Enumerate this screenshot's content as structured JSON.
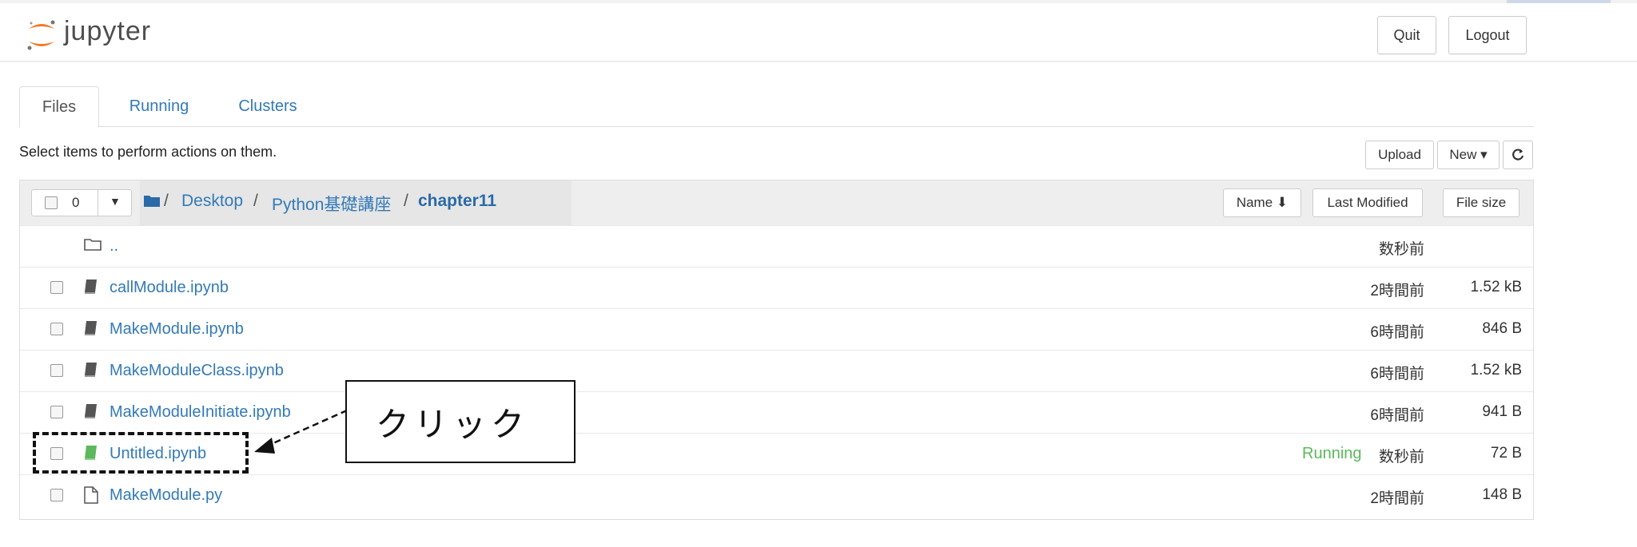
{
  "app": {
    "logo_text": "jupyter"
  },
  "header": {
    "quit_label": "Quit",
    "logout_label": "Logout"
  },
  "tabs": [
    {
      "label": "Files",
      "active": true
    },
    {
      "label": "Running",
      "active": false
    },
    {
      "label": "Clusters",
      "active": false
    }
  ],
  "hint": "Select items to perform actions on them.",
  "toolbar": {
    "upload_label": "Upload",
    "new_label": "New ▾",
    "refresh_icon": "refresh-icon"
  },
  "list": {
    "selected_count": "0",
    "breadcrumb": [
      "Desktop",
      "Python基礎講座",
      "chapter11"
    ],
    "sort": {
      "name_label": "Name ⬇",
      "modified_label": "Last Modified",
      "size_label": "File size"
    },
    "rows": [
      {
        "name": "..",
        "icon": "folder-icon",
        "status": "",
        "modified": "数秒前",
        "size": ""
      },
      {
        "name": "callModule.ipynb",
        "icon": "notebook-icon",
        "status": "",
        "modified": "2時間前",
        "size": "1.52 kB"
      },
      {
        "name": "MakeModule.ipynb",
        "icon": "notebook-icon",
        "status": "",
        "modified": "6時間前",
        "size": "846 B"
      },
      {
        "name": "MakeModuleClass.ipynb",
        "icon": "notebook-icon",
        "status": "",
        "modified": "6時間前",
        "size": "1.52 kB"
      },
      {
        "name": "MakeModuleInitiate.ipynb",
        "icon": "notebook-icon",
        "status": "",
        "modified": "6時間前",
        "size": "941 B"
      },
      {
        "name": "Untitled.ipynb",
        "icon": "notebook-running-icon",
        "status": "Running",
        "modified": "数秒前",
        "size": "72 B"
      },
      {
        "name": "MakeModule.py",
        "icon": "file-icon",
        "status": "",
        "modified": "2時間前",
        "size": "148 B"
      }
    ]
  },
  "annotation": {
    "text": "クリック"
  },
  "colors": {
    "link": "#337ab7",
    "running": "#5cb85c",
    "logo_orange": "#f37726"
  }
}
